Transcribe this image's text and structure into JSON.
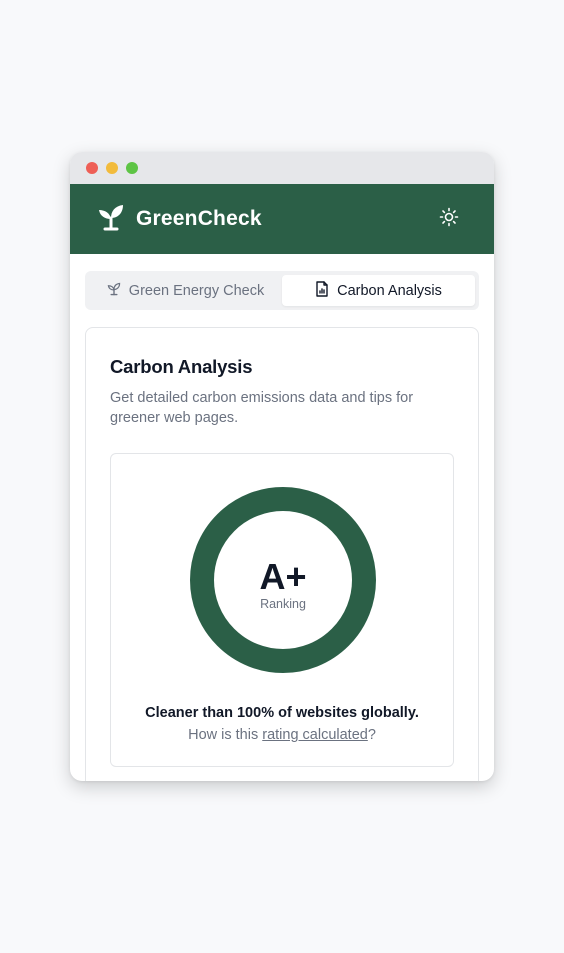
{
  "app": {
    "name": "GreenCheck"
  },
  "header": {
    "logo_icon": "seedling-icon",
    "theme_icon": "sun-icon"
  },
  "tabs": [
    {
      "label": "Green Energy Check",
      "icon": "seedling-icon",
      "active": false
    },
    {
      "label": "Carbon Analysis",
      "icon": "document-chart-icon",
      "active": true
    }
  ],
  "card": {
    "title": "Carbon Analysis",
    "description": "Get detailed carbon emissions data and tips for greener web pages."
  },
  "rating": {
    "grade": "A+",
    "label": "Ranking",
    "summary": "Cleaner than 100% of websites globally.",
    "how_prefix": "How is this ",
    "how_link": "rating calculated",
    "how_suffix": "?"
  },
  "colors": {
    "brand": "#2b5f47",
    "ring": "#2b5f47",
    "text_primary": "#111827",
    "text_muted": "#6b7280"
  }
}
